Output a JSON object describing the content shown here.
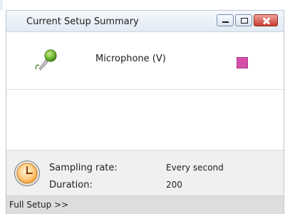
{
  "window": {
    "title": "Current Setup Summary",
    "buttons": {
      "minimize": "minimize-icon",
      "maximize": "maximize-icon",
      "close": "close-icon"
    }
  },
  "sensor": {
    "label": "Microphone (V)",
    "icon": "microphone-icon",
    "color": "#d64fa7"
  },
  "summary": {
    "icon": "clock-icon",
    "sampling_label": "Sampling rate:",
    "sampling_value": "Every second",
    "duration_label": "Duration:",
    "duration_value": "200"
  },
  "footer": {
    "full_setup_label": "Full Setup >>"
  }
}
